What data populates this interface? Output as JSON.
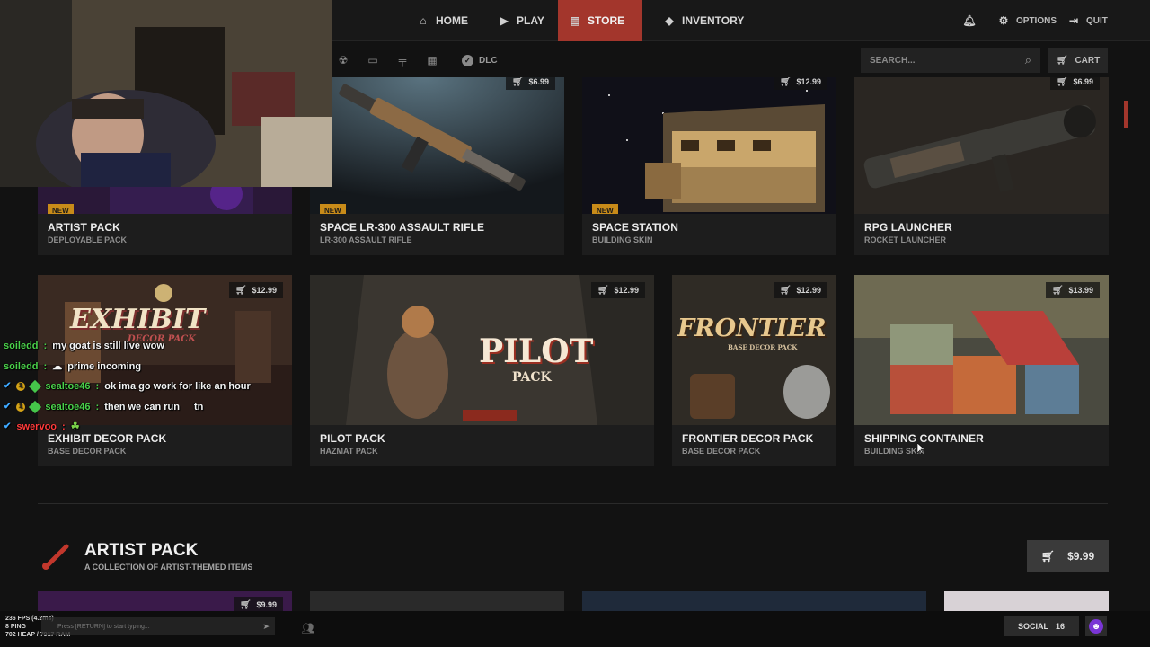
{
  "nav": {
    "home": "HOME",
    "play": "PLAY",
    "store": "STORE",
    "inventory": "INVENTORY",
    "options": "OPTIONS",
    "quit": "QUIT"
  },
  "toolbar": {
    "dlc_label": "DLC",
    "search_placeholder": "SEARCH...",
    "cart_label": "CART"
  },
  "row1": [
    {
      "badge": "NEW",
      "title": "ARTIST PACK",
      "subtitle": "DEPLOYABLE PACK"
    },
    {
      "badge": "NEW",
      "title": "SPACE LR-300 ASSAULT RIFLE",
      "subtitle": "LR-300 ASSAULT RIFLE",
      "price": "$6.99"
    },
    {
      "badge": "NEW",
      "title": "SPACE STATION",
      "subtitle": "BUILDING SKIN",
      "price": "$12.99"
    },
    {
      "title": "RPG LAUNCHER",
      "subtitle": "ROCKET LAUNCHER",
      "price": "$6.99"
    }
  ],
  "row2": [
    {
      "title": "EXHIBIT DECOR PACK",
      "subtitle": "BASE DECOR PACK",
      "price": "$12.99",
      "art_text": "EXHIBIT",
      "art_sub": "DECOR PACK"
    },
    {
      "title": "PILOT PACK",
      "subtitle": "HAZMAT PACK",
      "price": "$12.99",
      "art_text": "PILOT",
      "art_sub": "PACK"
    },
    {
      "title": "FRONTIER DECOR PACK",
      "subtitle": "BASE DECOR PACK",
      "price": "$12.99",
      "art_text": "FRONTIER",
      "art_sub": "BASE DECOR PACK"
    },
    {
      "title": "SHIPPING CONTAINER",
      "subtitle": "BUILDING SKIN",
      "price": "$13.99"
    }
  ],
  "section": {
    "title": "ARTIST PACK",
    "subtitle": "A COLLECTION OF ARTIST-THEMED ITEMS",
    "price": "$9.99",
    "preview_price": "$9.99"
  },
  "bottom": {
    "fps": "236 FPS (4.2ms)",
    "ping": "8 PING",
    "heap": "702 HEAP / 7917 RAM",
    "console_placeholder": "Press [RETURN] to start typing...",
    "social_label": "SOCIAL",
    "social_count": "16"
  },
  "chat": [
    {
      "user": "soiledd",
      "message": "my goat is still live wow"
    },
    {
      "user": "soiledd",
      "message": "prime incoming"
    },
    {
      "user": "sealtoe46",
      "message": "ok ima go work for like an hour"
    },
    {
      "user": "sealtoe46",
      "message": "then we can run",
      "extra": "tn"
    },
    {
      "user": "swervoo"
    }
  ],
  "colors": {
    "accent_red": "#a3362c",
    "badge_new": "#c88b19",
    "background": "#121212"
  }
}
